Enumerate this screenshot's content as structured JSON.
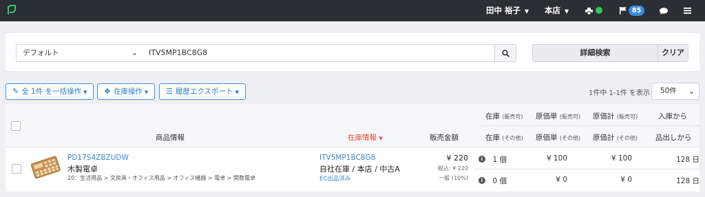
{
  "topbar": {
    "user": "田中 裕子",
    "store": "本店",
    "notification_count": "85"
  },
  "search": {
    "preset": "デフォルト",
    "query": "ITV5MP1BC8G8",
    "advanced_label": "詳細検索",
    "clear_label": "クリア"
  },
  "actions": {
    "bulk_label": "全 1件 を一括操作",
    "stock_label": "在庫操作",
    "export_label": "履歴エクスポート"
  },
  "pagination": {
    "count_text": "1件中 1-1件 を表示",
    "per_page": "50件"
  },
  "table": {
    "headers": {
      "stock_available": "在庫",
      "stock_available_sub": "(販売可)",
      "unit_cost_available": "原価単",
      "unit_cost_available_sub": "(販売可)",
      "total_cost_available": "原価計",
      "total_cost_available_sub": "(販売可)",
      "days_since_arrival": "入庫から",
      "product_info": "商品情報",
      "stock_info": "在庫情報",
      "sale_price": "販売金額",
      "stock_other": "在庫",
      "stock_other_sub": "(その他)",
      "unit_cost_other": "原価単",
      "unit_cost_other_sub": "(その他)",
      "total_cost_other": "原価計",
      "total_cost_other_sub": "(その他)",
      "days_since_listing": "品出しから"
    },
    "rows": [
      {
        "sku": "PD17S4ZBZUDW",
        "name": "木製電卓",
        "category": "20：生活用品 > 文房具・オフィス用品 > オフィス機器 > 電卓 > 関数電卓",
        "stock_code": "ITV5MP1BC8G8",
        "location": "自社在庫 / 本店 / 中古A",
        "ec_status": "EC出品済み",
        "price": "¥ 220",
        "price_tax": "税込: ¥ 220",
        "tax_rate": "一般 (10%)",
        "stock_available": "1 個",
        "unit_cost_available": "¥ 100",
        "total_cost_available": "¥ 100",
        "days_arrival": "128 日",
        "stock_other": "0 個",
        "unit_cost_other": "¥ 0",
        "total_cost_other": "¥ 0",
        "days_listing": "128 日"
      }
    ]
  }
}
